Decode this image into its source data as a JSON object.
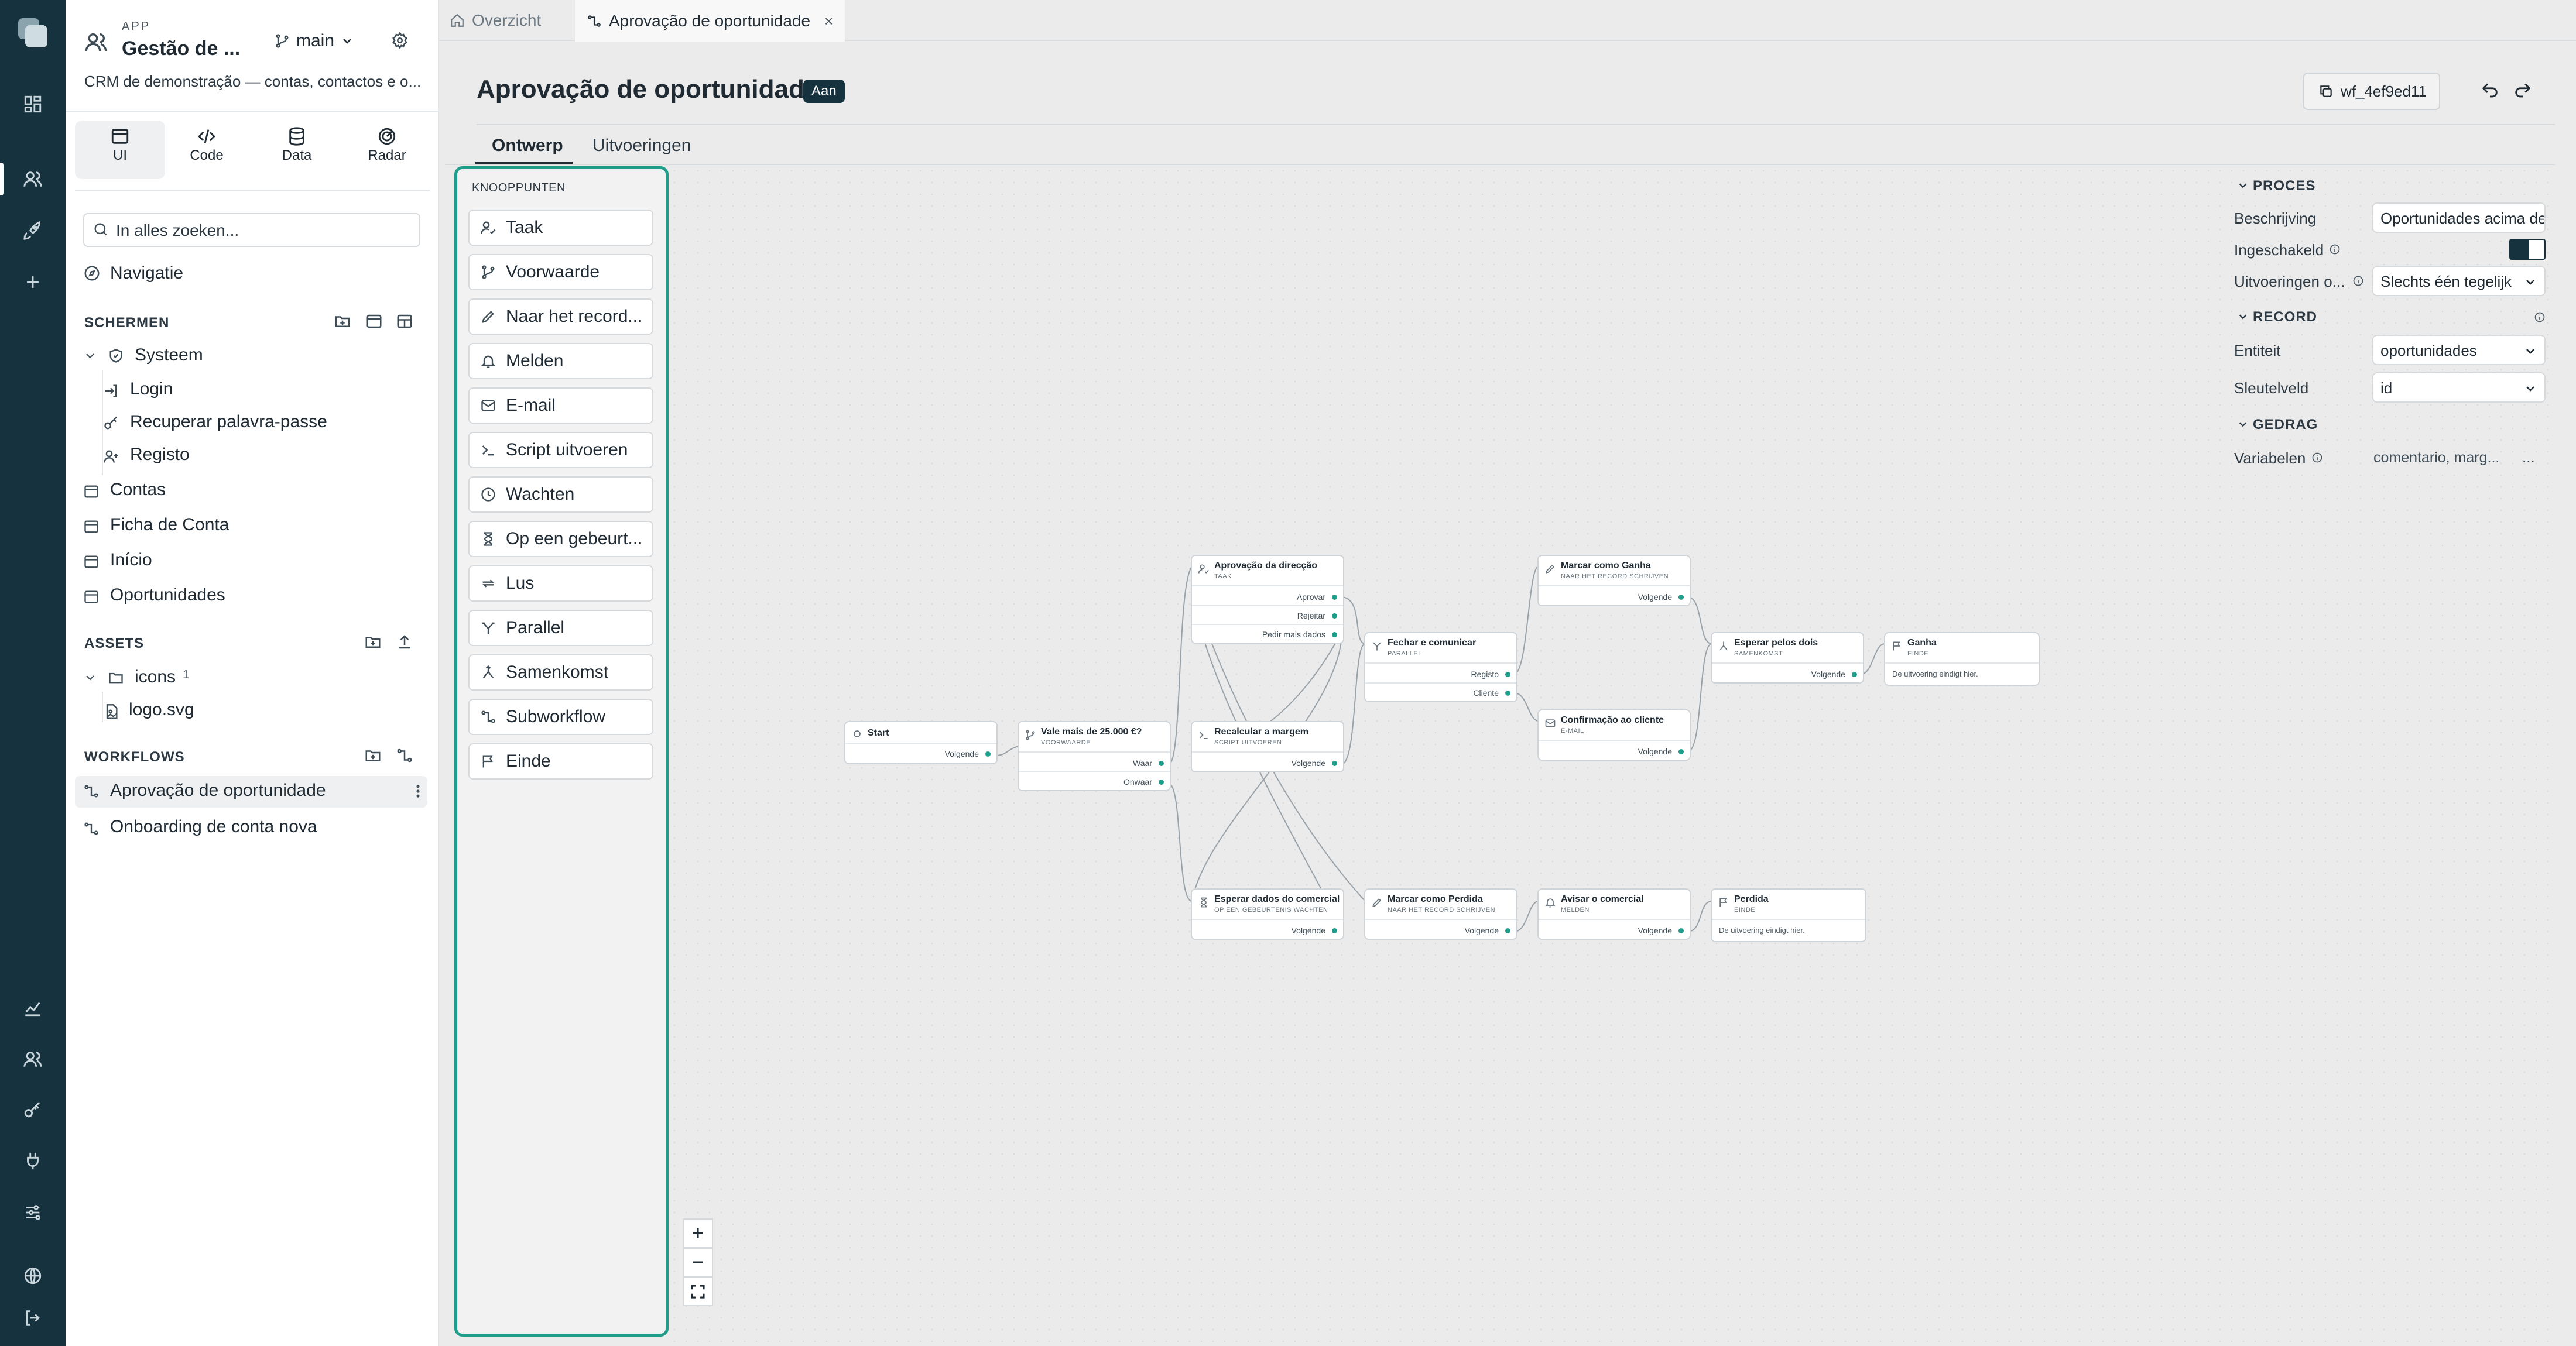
{
  "app": {
    "label": "APP",
    "name": "Gestão de ...",
    "branch": "main",
    "description": "CRM de demonstração — contas, contactos e o..."
  },
  "module_tabs": [
    {
      "label": "UI",
      "icon": "window-icon"
    },
    {
      "label": "Code",
      "icon": "code-icon"
    },
    {
      "label": "Data",
      "icon": "database-icon"
    },
    {
      "label": "Radar",
      "icon": "radar-icon"
    }
  ],
  "search": {
    "placeholder": "In alles zoeken..."
  },
  "nav": {
    "label": "Navigatie"
  },
  "screens": {
    "heading": "SCHERMEN",
    "group": "Systeem",
    "group_items": [
      "Login",
      "Recuperar palavra-passe",
      "Registo"
    ],
    "items": [
      "Contas",
      "Ficha de Conta",
      "Início",
      "Oportunidades"
    ]
  },
  "assets": {
    "heading": "ASSETS",
    "folder": "icons",
    "folder_count": "1",
    "file": "logo.svg"
  },
  "workflows": {
    "heading": "WORKFLOWS",
    "items": [
      "Aprovação de oportunidade",
      "Onboarding de conta nova"
    ]
  },
  "tabs": [
    {
      "label": "Overzicht",
      "icon": "home-icon"
    },
    {
      "label": "Aprovação de oportunidade",
      "icon": "workflow-icon",
      "close": "×"
    }
  ],
  "page": {
    "title": "Aprovação de oportunidade",
    "status": "Aan",
    "workflow_id": "wf_4ef9ed11"
  },
  "subtabs": [
    "Ontwerp",
    "Uitvoeringen"
  ],
  "palette": {
    "heading": "KNOOPPUNTEN",
    "items": [
      "Taak",
      "Voorwaarde",
      "Naar het record...",
      "Melden",
      "E-mail",
      "Script uitvoeren",
      "Wachten",
      "Op een gebeurt...",
      "Lus",
      "Parallel",
      "Samenkomst",
      "Subworkflow",
      "Einde"
    ]
  },
  "flow": {
    "start": {
      "title": "Start",
      "port": "Volgende"
    },
    "cond": {
      "title": "Vale mais de 25.000 €?",
      "sub": "VOORWAARDE",
      "ports": [
        "Waar",
        "Onwaar"
      ]
    },
    "approval": {
      "title": "Aprovação da direcção",
      "sub": "TAAK",
      "ports": [
        "Aprovar",
        "Rejeitar",
        "Pedir mais dados"
      ]
    },
    "recalc": {
      "title": "Recalcular a margem",
      "sub": "SCRIPT UITVOEREN",
      "port": "Volgende"
    },
    "wait_data": {
      "title": "Esperar dados do comercial",
      "sub": "OP EEN GEBEURTENIS WACHTEN",
      "port": "Volgende"
    },
    "close": {
      "title": "Fechar e comunicar",
      "sub": "PARALLEL",
      "ports": [
        "Registo",
        "Cliente"
      ]
    },
    "lost": {
      "title": "Marcar como Perdida",
      "sub": "NAAR HET RECORD SCHRIJVEN",
      "port": "Volgende"
    },
    "won_mark": {
      "title": "Marcar como Ganha",
      "sub": "NAAR HET RECORD SCHRIJVEN",
      "port": "Volgende"
    },
    "confirm": {
      "title": "Confirmação ao cliente",
      "sub": "E-MAIL",
      "port": "Volgende"
    },
    "notify": {
      "title": "Avisar o comercial",
      "sub": "MELDEN",
      "port": "Volgende"
    },
    "join": {
      "title": "Esperar pelos dois",
      "sub": "SAMENKOMST",
      "port": "Volgende"
    },
    "end_won": {
      "title": "Ganha",
      "sub": "EINDE",
      "note": "De uitvoering eindigt hier."
    },
    "end_lost": {
      "title": "Perdida",
      "sub": "EINDE",
      "note": "De uitvoering eindigt hier."
    }
  },
  "panel": {
    "proces": {
      "heading": "PROCES",
      "description_label": "Beschrijving",
      "description_value": "Oportunidades acima de",
      "enabled_label": "Ingeschakeld",
      "enabled": true,
      "runs_label": "Uitvoeringen o...",
      "runs_value": "Slechts één tegelijk"
    },
    "record": {
      "heading": "RECORD",
      "entity_label": "Entiteit",
      "entity_value": "oportunidades",
      "key_label": "Sleutelveld",
      "key_value": "id"
    },
    "gedrag": {
      "heading": "GEDRAG",
      "variables_label": "Variabelen",
      "variables_value": "comentario, marg...",
      "more": "..."
    }
  },
  "colors": {
    "rail": "#16323f",
    "accent": "#1e9d8a",
    "badge": "#16323f"
  }
}
